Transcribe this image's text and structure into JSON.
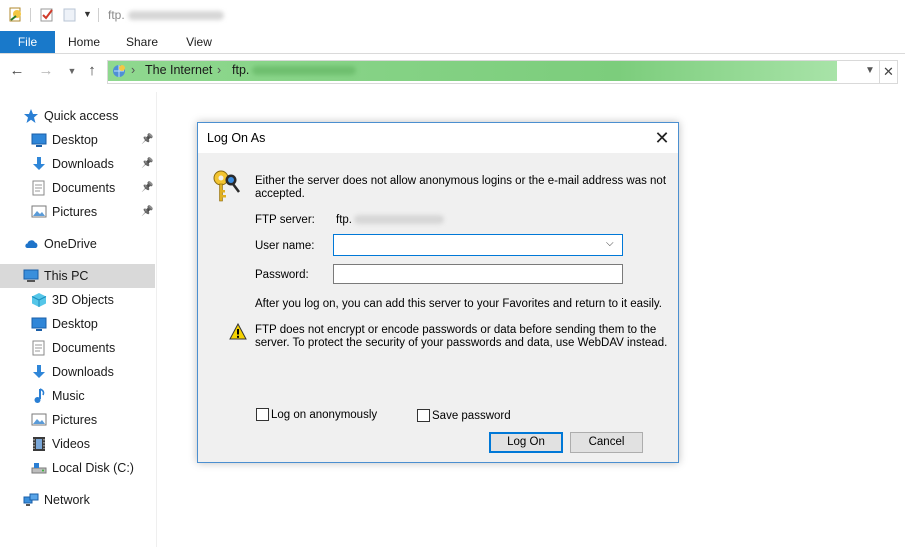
{
  "window": {
    "title_prefix": "ftp.",
    "quick_access_toolbar": [
      "properties-icon",
      "checkmark-icon",
      "new-folder-icon",
      "customize-dropdown-icon"
    ]
  },
  "ribbon": {
    "tabs": [
      "File",
      "Home",
      "Share",
      "View"
    ]
  },
  "address": {
    "crumbs": [
      "The Internet",
      "ftp."
    ],
    "icons": {
      "back": "back-arrow-icon",
      "forward": "forward-arrow-icon",
      "recent": "recent-locations-icon",
      "up": "up-arrow-icon"
    }
  },
  "nav": {
    "items": [
      {
        "label": "Quick access",
        "icon": "star-icon",
        "indent": 0,
        "pinned": false
      },
      {
        "label": "Desktop",
        "icon": "desktop-icon",
        "indent": 1,
        "pinned": true
      },
      {
        "label": "Downloads",
        "icon": "download-icon",
        "indent": 1,
        "pinned": true
      },
      {
        "label": "Documents",
        "icon": "document-icon",
        "indent": 1,
        "pinned": true
      },
      {
        "label": "Pictures",
        "icon": "pictures-icon",
        "indent": 1,
        "pinned": true
      },
      {
        "label": "OneDrive",
        "icon": "cloud-icon",
        "indent": 0,
        "pinned": false
      },
      {
        "label": "This PC",
        "icon": "computer-icon",
        "indent": 0,
        "pinned": false,
        "selected": true
      },
      {
        "label": "3D Objects",
        "icon": "cube-icon",
        "indent": 1,
        "pinned": false
      },
      {
        "label": "Desktop",
        "icon": "desktop-icon",
        "indent": 1,
        "pinned": false
      },
      {
        "label": "Documents",
        "icon": "document-icon",
        "indent": 1,
        "pinned": false
      },
      {
        "label": "Downloads",
        "icon": "download-icon",
        "indent": 1,
        "pinned": false
      },
      {
        "label": "Music",
        "icon": "music-icon",
        "indent": 1,
        "pinned": false
      },
      {
        "label": "Pictures",
        "icon": "pictures-icon",
        "indent": 1,
        "pinned": false
      },
      {
        "label": "Videos",
        "icon": "video-icon",
        "indent": 1,
        "pinned": false
      },
      {
        "label": "Local Disk (C:)",
        "icon": "disk-icon",
        "indent": 1,
        "pinned": false
      },
      {
        "label": "Network",
        "icon": "network-icon",
        "indent": 0,
        "pinned": false
      }
    ]
  },
  "dialog": {
    "title": "Log On As",
    "message_line1": "Either the server does not allow anonymous logins or the e-mail address was not",
    "message_line2": "accepted.",
    "ftp_server_label": "FTP server:",
    "ftp_server_value": "ftp.",
    "username_label": "User name:",
    "username_value": "",
    "password_label": "Password:",
    "password_value": "",
    "info_text": "After you log on, you can add this server to your Favorites and return to it easily.",
    "warning_line1": "FTP does not encrypt or encode passwords or data before sending them to the",
    "warning_line2": "server.  To protect the security of your passwords and data, use WebDAV instead.",
    "anonymous_label": "Log on anonymously",
    "anonymous_checked": false,
    "save_password_label": "Save password",
    "save_password_checked": false,
    "logon_button": "Log On",
    "cancel_button": "Cancel"
  },
  "colors": {
    "file_tab": "#1979ca",
    "address_green": "#7ccd7c",
    "dialog_border": "#4b8fd0",
    "focus_blue": "#0078d7",
    "selected_nav": "#d9d9d9"
  }
}
